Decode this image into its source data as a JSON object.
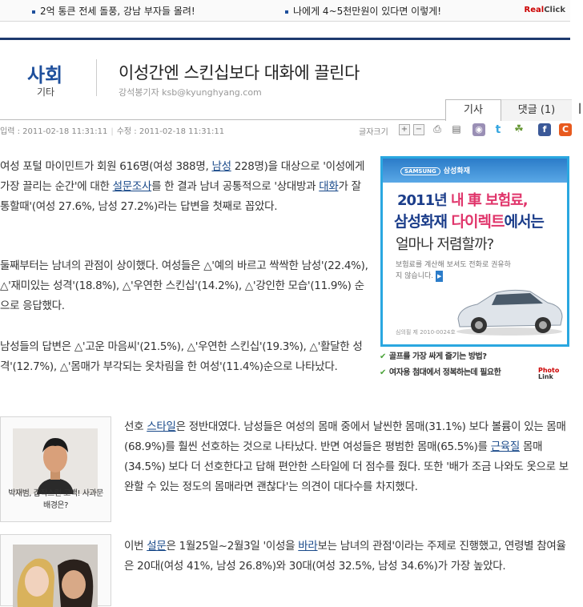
{
  "top_ads": {
    "item1": "2억 통큰 전세 돌풍, 강남 부자들 몰려!",
    "item2": "나에게 4~5천만원이 있다면 이렇게!",
    "brand_pre": "Real",
    "brand_post": "Click"
  },
  "section": {
    "main": "사회",
    "sub": "기타"
  },
  "article": {
    "headline": "이성간엔 스킨십보다 대화에 끌린다",
    "byline": "강석봉기자 ksb@kyunghyang.com",
    "tabs": {
      "article": "기사",
      "comments": "댓글 (1)"
    },
    "input_label": "입력 : 2011-02-18 11:31:11",
    "modified_label": "수정 : 2011-02-18 11:31:11",
    "font_size_label": "글자크기",
    "p1_a": "여성 포털 마이민트가 회원 616명(여성 388명, ",
    "p1_link1": "남성",
    "p1_b": " 228명)을 대상으로 '이성에게 가장 끌리는 순간'에 대한 ",
    "p1_link2": "설문조사",
    "p1_c": "를 한 결과 남녀 공통적으로 '상대방과 ",
    "p1_link3": "대화",
    "p1_d": "가 잘 통할때'(여성 27.6%, 남성 27.2%)라는 답변을 첫째로 꼽았다.",
    "p2": "둘째부터는 남녀의 관점이 상이했다. 여성들은 △'예의 바르고 싹싹한 남성'(22.4%), △'재미있는 성격'(18.8%), △'우연한 스킨십'(14.2%), △'강인한 모습'(11.9%) 순으로 응답했다.",
    "p3": "남성들의 답변은 △'고운 마음씨'(21.5%), △'우연한 스킨십'(19.3%), △'활달한 성격'(12.7%), △'몸매가 부각되는 옷차림을 한 여성'(11.4%)순으로 나타났다.",
    "p4_a": "선호 ",
    "p4_link1": "스타일",
    "p4_b": "은 정반대였다. 남성들은 여성의 몸매 중에서 날씬한 몸매(31.1%) 보다 볼륨이 있는 몸매(68.9%)를 훨씬 선호하는 것으로 나타났다. 반면 여성들은 평범한 몸매(65.5%)를 ",
    "p4_link2": "근육질",
    "p4_c": " 몸매(34.5%) 보다 더 선호한다고 답해 편안한 스타일에 더 점수를 줬다. 또한 '배가 조금 나와도 옷으로 보완할 수 있는 정도의 몸매라면 괜찮다'는 의견이 대다수를 차지했다.",
    "p5_a": "이번 ",
    "p5_link1": "설문",
    "p5_b": "은 1월25일~2월3일 '이성을 ",
    "p5_link2": "바라",
    "p5_c": "보는 남녀의 관점'이라는 주제로 진행했고, 연령별 참여율은 20대(여성 41%, 남성 26.8%)와 30대(여성 32.5%, 남성 34.6%)가 가장 높았다."
  },
  "ad": {
    "brand": "삼성화재",
    "brand_small": "SAMSUNG",
    "line1_a": "2011년 ",
    "line1_b": "내 車 보험료,",
    "line2_a": "삼성화재 ",
    "line2_b": "다이렉트",
    "line2_c": "에서는",
    "line3": "얼마나 저렴할까?",
    "line4": "보험료를 계산해 보셔도 전화로 권유하지 않습니다.",
    "fine": "심의필 제 2010-0024호"
  },
  "ad_links": {
    "l1": "골프를 가장 싸게 즐기는 방법?",
    "l2": "여자용 첨대에서 정복하는데 필요한"
  },
  "photo_link": {
    "top": "Photo",
    "bottom": "Link"
  },
  "photos": {
    "p1_caption": "박재범, 갑작스런 고백! 사과문 배경은?"
  }
}
